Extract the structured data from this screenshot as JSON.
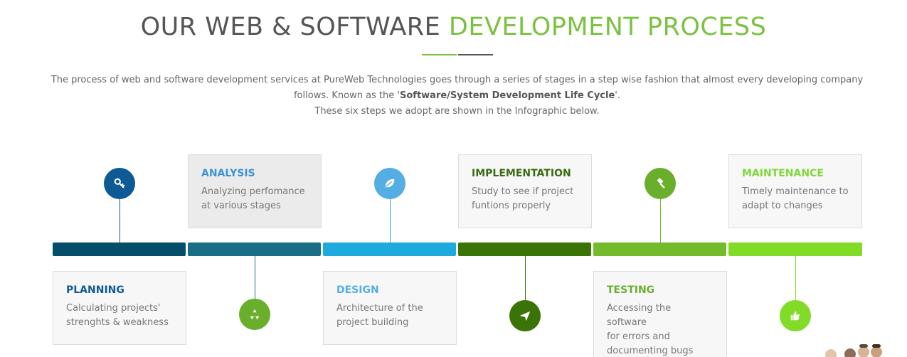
{
  "title": {
    "main": "OUR WEB & SOFTWARE",
    "accent": "DEVELOPMENT PROCESS"
  },
  "intro": {
    "line1": "The process of web and software development services at PureWeb Technologies goes through a series of stages in a step wise fashion that almost every developing company follows. Known as the '",
    "bold": "Software/System Development Life Cycle",
    "line1_end": "'.",
    "line2": "These six steps we adopt are shown in the Infographic below."
  },
  "steps": [
    {
      "title": "PLANNING",
      "line1": "Calculating projects'",
      "line2": "strenghts & weakness",
      "line3": "",
      "color": "#0d5a94",
      "bar": "#044e69",
      "icon": "key-icon"
    },
    {
      "title": "ANALYSIS",
      "line1": "Analyzing perfomance",
      "line2": "at various stages",
      "line3": "",
      "color": "#3a94d1",
      "bar": "#1a6d86",
      "icon": "recycle-icon"
    },
    {
      "title": "DESIGN",
      "line1": "Architecture of the",
      "line2": "project building",
      "line3": "",
      "color": "#55aee3",
      "bar": "#1eaadd",
      "icon": "leaf-icon"
    },
    {
      "title": "IMPLEMENTATION",
      "line1": "Study to see if project",
      "line2": "funtions properly",
      "line3": "",
      "color": "#3a6b14",
      "bar": "#3a7306",
      "icon": "paper-plane-icon"
    },
    {
      "title": "TESTING",
      "line1": "Accessing the software",
      "line2": "for errors and",
      "line3": "documenting bugs",
      "color": "#6aaf2c",
      "bar": "#74bb2c",
      "icon": "gavel-icon"
    },
    {
      "title": "MAINTENANCE",
      "line1": "Timely maintenance to",
      "line2": "adapt to changes",
      "line3": "",
      "color": "#7fd83a",
      "bar": "#82dc27",
      "icon": "thumbs-up-icon"
    }
  ]
}
